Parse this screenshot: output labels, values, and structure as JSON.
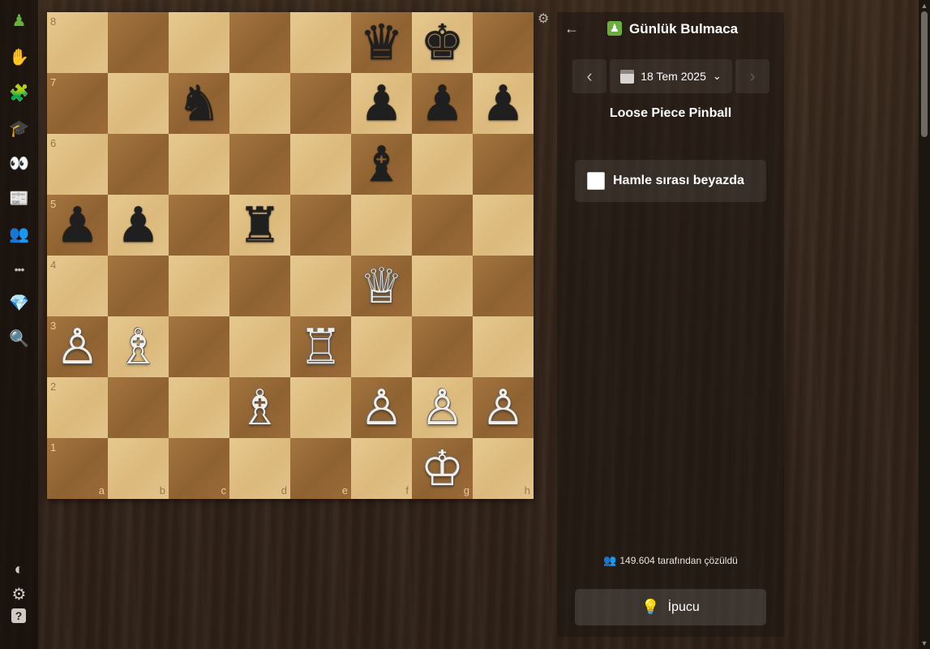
{
  "sidebar": {
    "items": [
      {
        "name": "home-pawn-icon",
        "glyph": "♟",
        "color": "#6aaf3c"
      },
      {
        "name": "play-hand-icon",
        "glyph": "✋",
        "color": "#e8d6c0"
      },
      {
        "name": "puzzles-icon",
        "glyph": "🧩",
        "color": "#e77b2b"
      },
      {
        "name": "learn-icon",
        "glyph": "🎓",
        "color": "#3b9ad9"
      },
      {
        "name": "watch-binoculars-icon",
        "glyph": "👀",
        "color": "#d8d8d8"
      },
      {
        "name": "news-icon",
        "glyph": "📰",
        "color": "#e0e0e0"
      },
      {
        "name": "social-icon",
        "glyph": "👥",
        "color": "#d9b38a"
      },
      {
        "name": "more-icon",
        "glyph": "•••",
        "color": "#bdb8b2"
      },
      {
        "name": "premium-diamond-icon",
        "glyph": "💎",
        "color": "#37b6f0"
      },
      {
        "name": "search-icon",
        "glyph": "🔍",
        "color": "#d8d4cf"
      }
    ],
    "bottom": [
      {
        "name": "theme-toggle-icon",
        "glyph": "◐",
        "color": "#cfcac4"
      },
      {
        "name": "settings-icon",
        "glyph": "⚙",
        "color": "#cfcac4"
      },
      {
        "name": "help-icon",
        "glyph": "?",
        "color": "#cfcac4"
      }
    ]
  },
  "board": {
    "ranks": [
      "8",
      "7",
      "6",
      "5",
      "4",
      "3",
      "2",
      "1"
    ],
    "files": [
      "a",
      "b",
      "c",
      "d",
      "e",
      "f",
      "g",
      "h"
    ],
    "pieces": [
      {
        "sq": "f8",
        "color": "black",
        "glyph": "♛"
      },
      {
        "sq": "g8",
        "color": "black",
        "glyph": "♚"
      },
      {
        "sq": "c7",
        "color": "black",
        "glyph": "♞"
      },
      {
        "sq": "f7",
        "color": "black",
        "glyph": "♟"
      },
      {
        "sq": "g7",
        "color": "black",
        "glyph": "♟"
      },
      {
        "sq": "h7",
        "color": "black",
        "glyph": "♟"
      },
      {
        "sq": "f6",
        "color": "black",
        "glyph": "♝"
      },
      {
        "sq": "a5",
        "color": "black",
        "glyph": "♟"
      },
      {
        "sq": "b5",
        "color": "black",
        "glyph": "♟"
      },
      {
        "sq": "d5",
        "color": "black",
        "glyph": "♜"
      },
      {
        "sq": "f4",
        "color": "white",
        "glyph": "♕"
      },
      {
        "sq": "a3",
        "color": "white",
        "glyph": "♙"
      },
      {
        "sq": "b3",
        "color": "white",
        "glyph": "♗"
      },
      {
        "sq": "e3",
        "color": "white",
        "glyph": "♖"
      },
      {
        "sq": "d2",
        "color": "white",
        "glyph": "♗"
      },
      {
        "sq": "f2",
        "color": "white",
        "glyph": "♙"
      },
      {
        "sq": "g2",
        "color": "white",
        "glyph": "♙"
      },
      {
        "sq": "h2",
        "color": "white",
        "glyph": "♙"
      },
      {
        "sq": "g1",
        "color": "white",
        "glyph": "♔"
      }
    ]
  },
  "panel": {
    "back_icon": "←",
    "title": "Günlük Bulmaca",
    "title_icon": "♟",
    "prev_icon": "‹",
    "next_icon": "›",
    "date": "18 Tem 2025",
    "date_chevron": "⌄",
    "puzzle_name": "Loose Piece Pinball",
    "turn_text": "Hamle sırası beyazda",
    "solved_text": "149.604 tarafından çözüldü",
    "solved_icon": "👥",
    "hint_label": "İpucu",
    "hint_icon": "💡"
  },
  "board_settings_icon": "⚙"
}
